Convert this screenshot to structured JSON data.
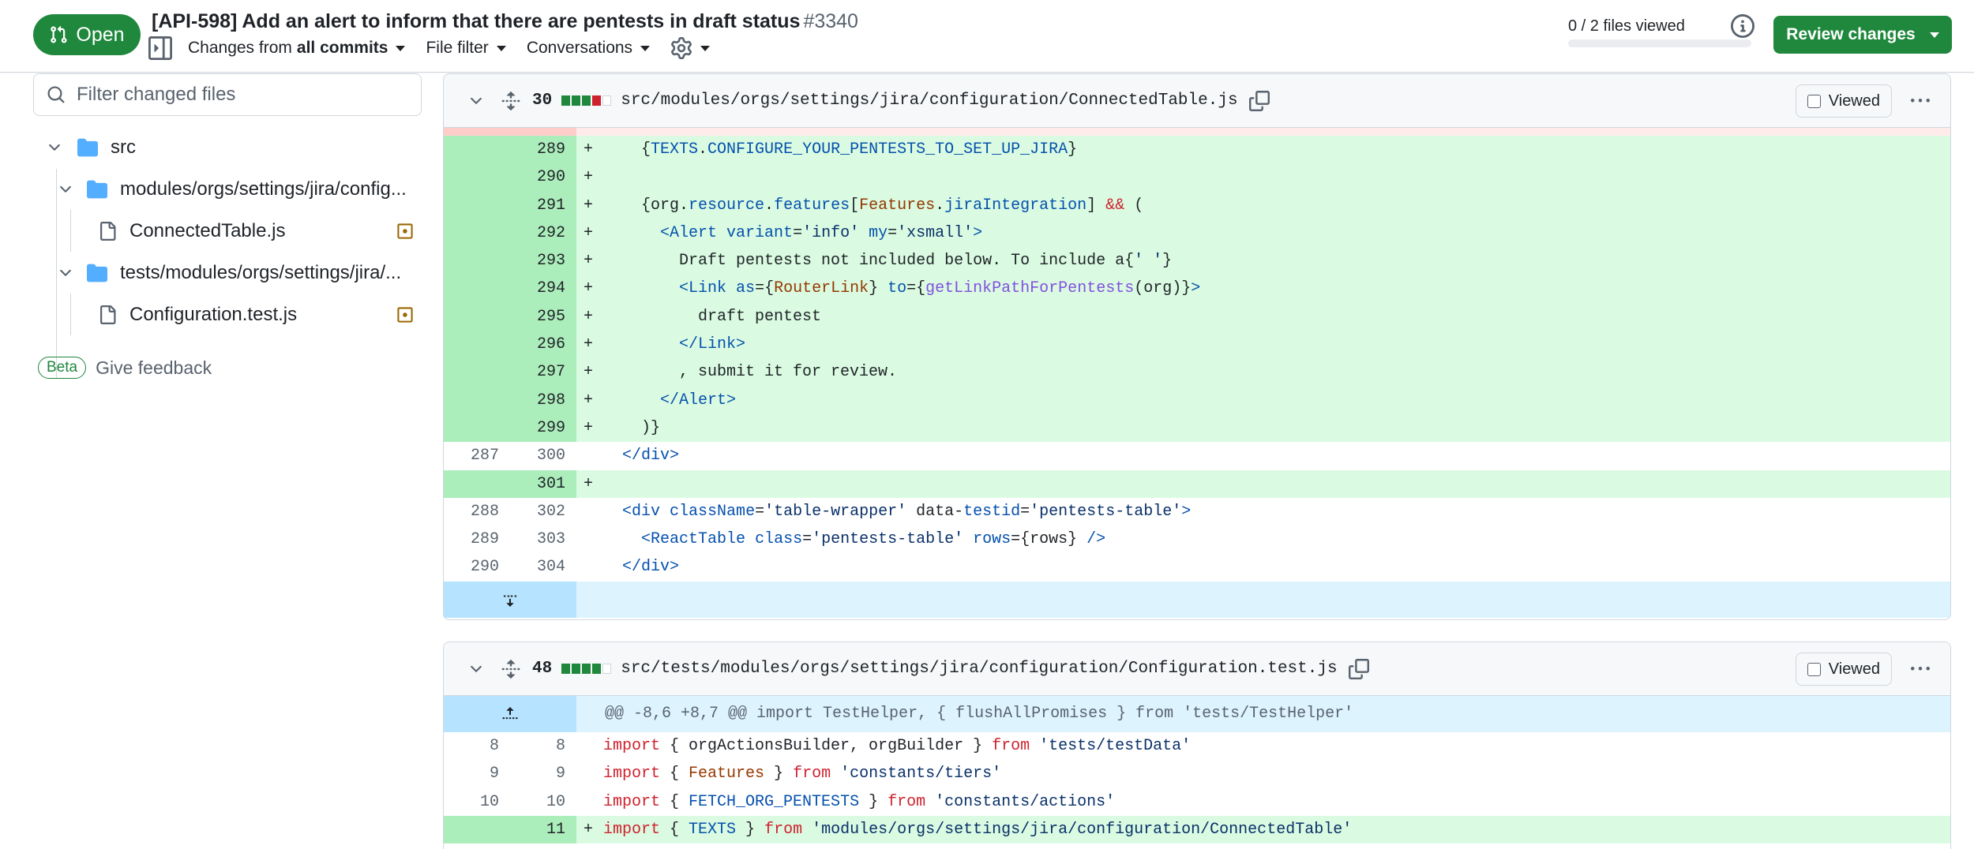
{
  "header": {
    "status_label": "Open",
    "title": "[API-598] Add an alert to inform that there are pentests in draft status",
    "number": "#3340",
    "changes_from_prefix": "Changes from",
    "changes_from_value": "all commits",
    "file_filter_label": "File filter",
    "conversations_label": "Conversations",
    "files_viewed": "0 / 2 files viewed",
    "files_viewed_fraction": 0,
    "review_button": "Review changes",
    "colors": {
      "open_green": "#1f883d",
      "added_bg": "#dafbe1",
      "added_gutter": "#aceebb",
      "hunk_bg": "#ddf4ff"
    }
  },
  "sidebar": {
    "filter_placeholder": "Filter changed files",
    "tree": [
      {
        "type": "folder",
        "label": "src",
        "icon": "folder-icon"
      },
      {
        "type": "folder",
        "label": "modules/orgs/settings/jira/config...",
        "icon": "folder-icon"
      },
      {
        "type": "file",
        "label": "ConnectedTable.js",
        "icon": "file-icon",
        "status": "modified"
      },
      {
        "type": "folder",
        "label": "tests/modules/orgs/settings/jira/...",
        "icon": "folder-icon"
      },
      {
        "type": "file",
        "label": "Configuration.test.js",
        "icon": "file-icon",
        "status": "modified"
      }
    ],
    "beta_label": "Beta",
    "feedback_label": "Give feedback"
  },
  "diff1": {
    "changes": "30",
    "path": "src/modules/orgs/settings/jira/configuration/ConnectedTable.js",
    "viewed_label": "Viewed",
    "rows": [
      {
        "old": "",
        "new": "289",
        "add": true,
        "code": "    {TEXTS.CONFIGURE_YOUR_PENTESTS_TO_SET_UP_JIRA}"
      },
      {
        "old": "",
        "new": "290",
        "add": true,
        "code": ""
      },
      {
        "old": "",
        "new": "291",
        "add": true,
        "code": "    {org.resource.features[Features.jiraIntegration] && ("
      },
      {
        "old": "",
        "new": "292",
        "add": true,
        "code": "      <Alert variant='info' my='xsmall'>"
      },
      {
        "old": "",
        "new": "293",
        "add": true,
        "code": "        Draft pentests not included below. To include a{' '}"
      },
      {
        "old": "",
        "new": "294",
        "add": true,
        "code": "        <Link as={RouterLink} to={getLinkPathForPentests(org)}>"
      },
      {
        "old": "",
        "new": "295",
        "add": true,
        "code": "          draft pentest"
      },
      {
        "old": "",
        "new": "296",
        "add": true,
        "code": "        </Link>"
      },
      {
        "old": "",
        "new": "297",
        "add": true,
        "code": "        , submit it for review."
      },
      {
        "old": "",
        "new": "298",
        "add": true,
        "code": "      </Alert>"
      },
      {
        "old": "",
        "new": "299",
        "add": true,
        "code": "    )}"
      },
      {
        "old": "287",
        "new": "300",
        "add": false,
        "code": "  </div>"
      },
      {
        "old": "",
        "new": "301",
        "add": true,
        "code": ""
      },
      {
        "old": "288",
        "new": "302",
        "add": false,
        "code": "  <div className='table-wrapper' data-testid='pentests-table'>"
      },
      {
        "old": "289",
        "new": "303",
        "add": false,
        "code": "    <ReactTable class='pentests-table' rows={rows} />"
      },
      {
        "old": "290",
        "new": "304",
        "add": false,
        "code": "  </div>"
      }
    ]
  },
  "diff2": {
    "changes": "48",
    "path": "src/tests/modules/orgs/settings/jira/configuration/Configuration.test.js",
    "viewed_label": "Viewed",
    "hunk": "@@ -8,6 +8,7 @@ import TestHelper, { flushAllPromises } from 'tests/TestHelper'",
    "rows": [
      {
        "old": "8",
        "new": "8",
        "add": false,
        "code": "import { orgActionsBuilder, orgBuilder } from 'tests/testData'"
      },
      {
        "old": "9",
        "new": "9",
        "add": false,
        "code": "import { Features } from 'constants/tiers'"
      },
      {
        "old": "10",
        "new": "10",
        "add": false,
        "code": "import { FETCH_ORG_PENTESTS } from 'constants/actions'"
      },
      {
        "old": "",
        "new": "11",
        "add": true,
        "code": "import { TEXTS } from 'modules/orgs/settings/jira/configuration/ConnectedTable'"
      }
    ]
  }
}
